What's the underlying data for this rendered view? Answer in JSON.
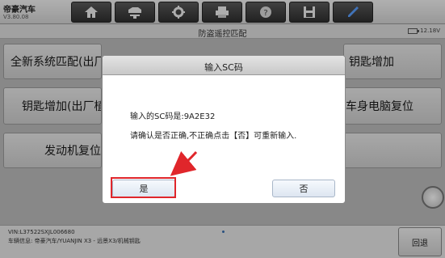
{
  "app": {
    "brand": "帝豪汽车",
    "version": "V3.80.08"
  },
  "toolbar": [
    {
      "icon": "home-icon"
    },
    {
      "icon": "car-lift-icon"
    },
    {
      "icon": "gear-icon"
    },
    {
      "icon": "printer-icon"
    },
    {
      "icon": "help-icon"
    },
    {
      "icon": "save-icon"
    },
    {
      "icon": "pen-icon"
    }
  ],
  "subheader": {
    "title": "防盗遥控匹配",
    "battery": "12.18V"
  },
  "main_buttons": [
    {
      "label": "全新系统匹配(出厂"
    },
    {
      "label": "钥匙增加(出厂植"
    },
    {
      "label": "发动机复位"
    },
    {
      "label": "钥匙增加"
    },
    {
      "label": "车身电脑复位"
    },
    {
      "label": ""
    }
  ],
  "footer": {
    "vin": "VIN:L37522SXJL006680",
    "vehicle": "车辆信息: 帝豪汽车/YUANJIN X3 - 远景X3/机械钥匙",
    "back_label": "回退"
  },
  "dialog": {
    "title": "输入SC码",
    "line1": "输入的SC码是:9A2E32",
    "line2": "请确认是否正确,不正确点击【否】可重新输入.",
    "yes_label": "是",
    "no_label": "否"
  },
  "colors": {
    "highlight": "#e0262b",
    "arrow": "#e0262b"
  }
}
